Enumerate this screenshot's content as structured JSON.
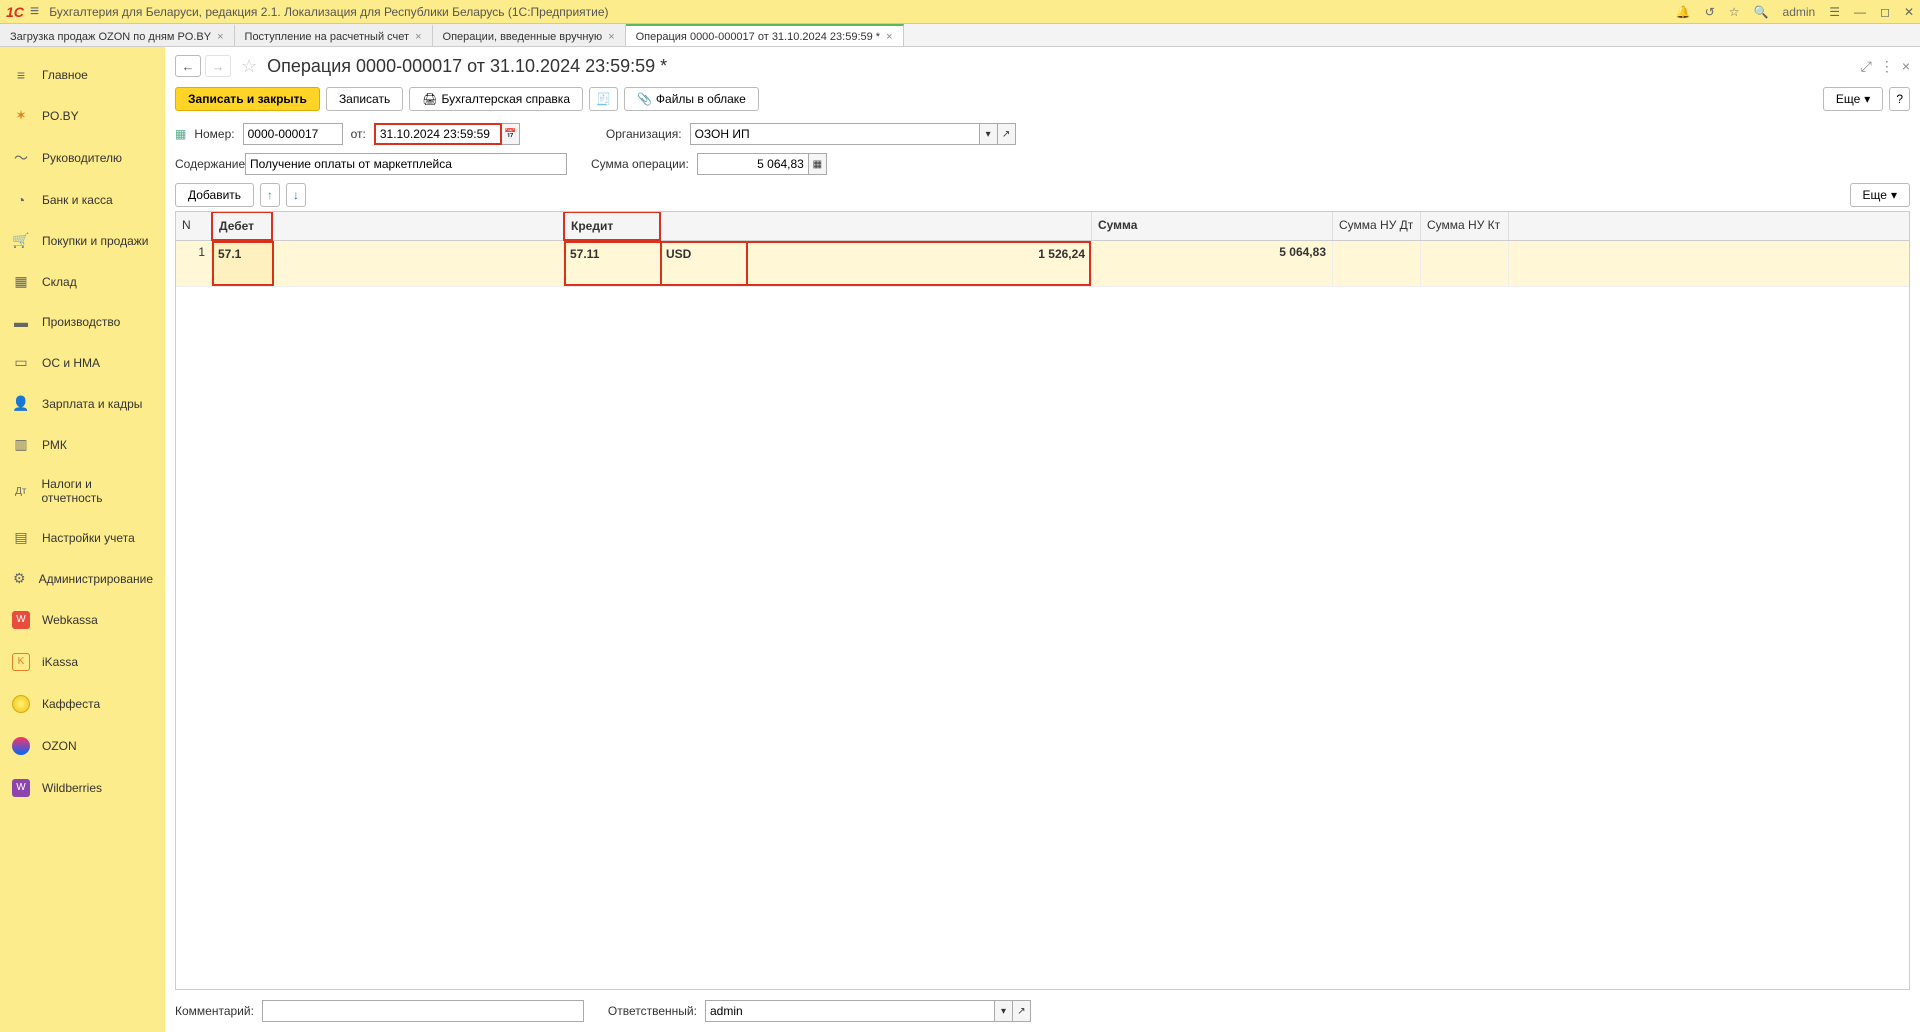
{
  "titlebar": {
    "app_title": "Бухгалтерия для Беларуси, редакция 2.1. Локализация для Республики Беларусь   (1С:Предприятие)",
    "user": "admin"
  },
  "tabs": [
    {
      "label": "Загрузка продаж OZON по дням PO.BY",
      "active": false
    },
    {
      "label": "Поступление на расчетный счет",
      "active": false
    },
    {
      "label": "Операции, введенные вручную",
      "active": false
    },
    {
      "label": "Операция 0000-000017 от 31.10.2024 23:59:59 *",
      "active": true
    }
  ],
  "sidebar": {
    "items": [
      {
        "label": "Главное",
        "icon": "≡"
      },
      {
        "label": "PO.BY",
        "icon": "✶"
      },
      {
        "label": "Руководителю",
        "icon": "〜"
      },
      {
        "label": "Банк и касса",
        "icon": "◔"
      },
      {
        "label": "Покупки и продажи",
        "icon": "🛒"
      },
      {
        "label": "Склад",
        "icon": "▦"
      },
      {
        "label": "Производство",
        "icon": "▬"
      },
      {
        "label": "ОС и НМА",
        "icon": "▭"
      },
      {
        "label": "Зарплата и кадры",
        "icon": "👤"
      },
      {
        "label": "РМК",
        "icon": "▥"
      },
      {
        "label": "Налоги и отчетность",
        "icon": "Дт"
      },
      {
        "label": "Настройки учета",
        "icon": "▤"
      },
      {
        "label": "Администрирование",
        "icon": "⚙"
      },
      {
        "label": "Webkassa",
        "icon": "W",
        "color": "#e74c3c"
      },
      {
        "label": "iKassa",
        "icon": "K",
        "color": "#e67e22"
      },
      {
        "label": "Каффеста",
        "icon": "●",
        "color": "#f1c40f"
      },
      {
        "label": "OZON",
        "icon": "◯",
        "color": "#0af"
      },
      {
        "label": "Wildberries",
        "icon": "W",
        "color": "#8e44ad"
      }
    ]
  },
  "page": {
    "title": "Операция 0000-000017 от 31.10.2024 23:59:59 *",
    "toolbar": {
      "save_close": "Записать и закрыть",
      "save": "Записать",
      "report": "Бухгалтерская справка",
      "files": "Файлы в облаке",
      "more": "Еще"
    },
    "fields": {
      "number_label": "Номер:",
      "number": "0000-000017",
      "date_label": "от:",
      "date": "31.10.2024 23:59:59",
      "org_label": "Организация:",
      "org": "ОЗОН ИП",
      "content_label": "Содержание:",
      "content": "Получение оплаты от маркетплейса",
      "sum_label": "Сумма операции:",
      "sum": "5 064,83"
    },
    "grid_toolbar": {
      "add": "Добавить",
      "more": "Еще"
    },
    "grid": {
      "columns": {
        "n": "N",
        "debet": "Дебет",
        "kredit": "Кредит",
        "sum": "Сумма",
        "nu_dt": "Сумма НУ Дт",
        "nu_kt": "Сумма НУ Кт"
      },
      "rows": [
        {
          "n": "1",
          "debet_acc": "57.1",
          "kredit_acc": "57.11",
          "kredit_cur": "USD",
          "kredit_val": "1 526,24",
          "sum": "5 064,83"
        }
      ]
    },
    "footer": {
      "comment_label": "Комментарий:",
      "comment": "",
      "resp_label": "Ответственный:",
      "resp": "admin"
    }
  }
}
